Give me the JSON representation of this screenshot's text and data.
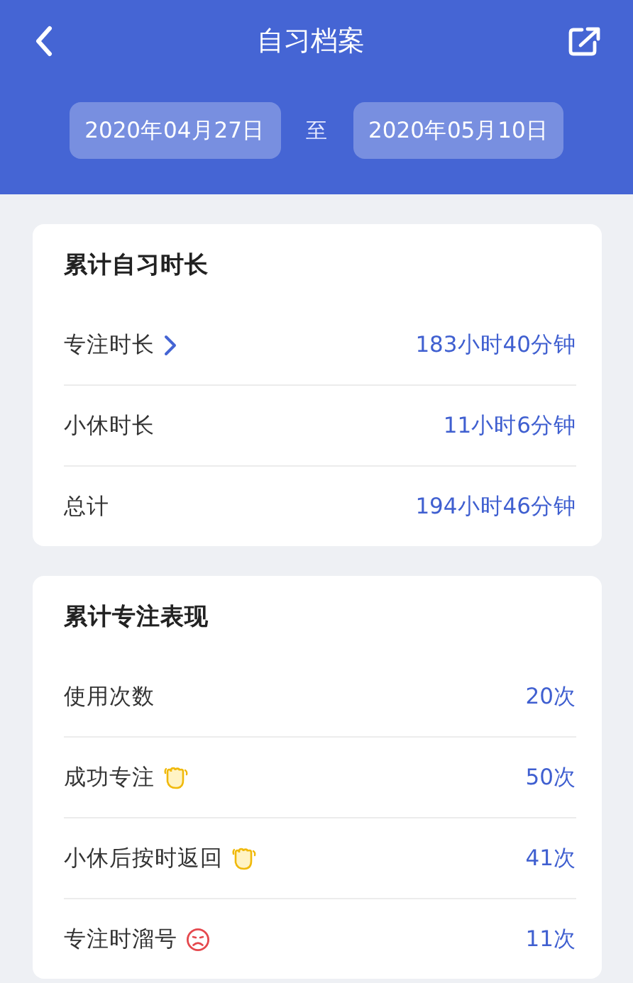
{
  "header": {
    "title": "自习档案",
    "date_from": "2020年04月27日",
    "separator": "至",
    "date_to": "2020年05月10日"
  },
  "cards": [
    {
      "title": "累计自习时长",
      "rows": [
        {
          "kind": "link",
          "label": "专注时长",
          "value": "183小时40分钟"
        },
        {
          "kind": "plain",
          "label": "小休时长",
          "value": "11小时6分钟"
        },
        {
          "kind": "plain",
          "label": "总计",
          "value": "194小时46分钟"
        }
      ]
    },
    {
      "title": "累计专注表现",
      "rows": [
        {
          "kind": "plain",
          "label": "使用次数",
          "value": "20次"
        },
        {
          "kind": "praise",
          "label": "成功专注",
          "value": "50次"
        },
        {
          "kind": "praise",
          "label": "小休后按时返回",
          "value": "41次"
        },
        {
          "kind": "warning",
          "label": "专注时溜号",
          "value": "11次"
        }
      ]
    }
  ]
}
